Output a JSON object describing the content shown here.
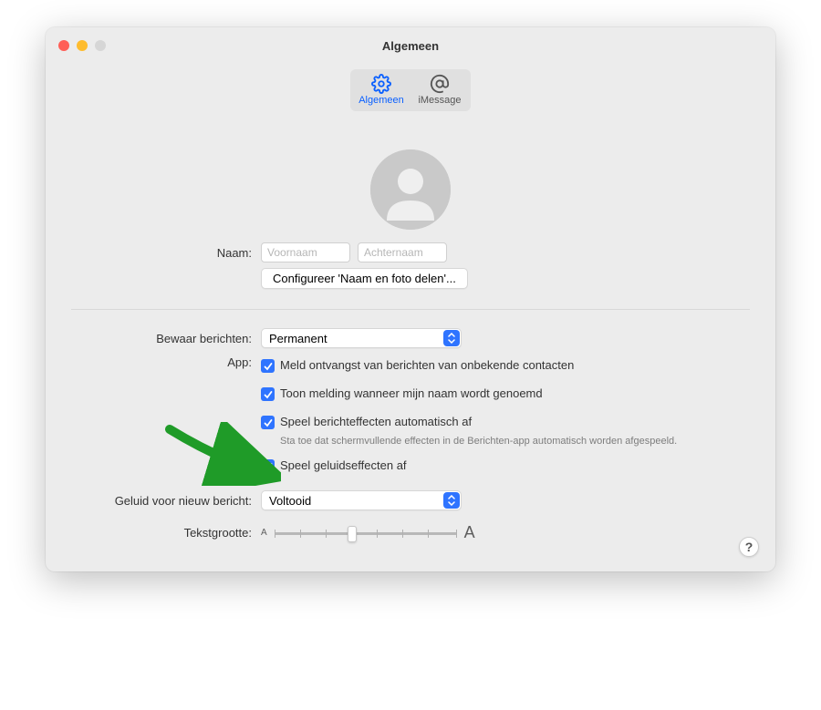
{
  "window": {
    "title": "Algemeen"
  },
  "tabs": {
    "general": "Algemeen",
    "imessage": "iMessage"
  },
  "profile": {
    "name_label": "Naam:",
    "first_placeholder": "Voornaam",
    "last_placeholder": "Achternaam",
    "share_button": "Configureer 'Naam en foto delen'..."
  },
  "settings": {
    "keep_label": "Bewaar berichten:",
    "keep_value": "Permanent",
    "app_label": "App:",
    "check1": "Meld ontvangst van berichten van onbekende contacten",
    "check2": "Toon melding wanneer mijn naam wordt genoemd",
    "check3": "Speel berichteffecten automatisch af",
    "check3_desc": "Sta toe dat schermvullende effecten in de Berichten-app automatisch worden afgespeeld.",
    "check4": "Speel geluidseffecten af",
    "sound_label": "Geluid voor nieuw bericht:",
    "sound_value": "Voltooid",
    "textsize_label": "Tekstgrootte:"
  },
  "help": "?"
}
